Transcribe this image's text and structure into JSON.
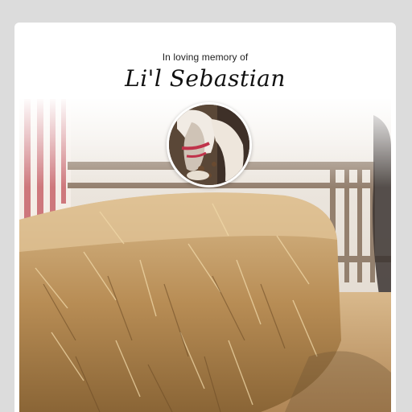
{
  "memorial": {
    "eyebrow": "In loving memory of",
    "name": "Li'l Sebastian"
  },
  "colors": {
    "page_bg": "#dcdcdc",
    "card_bg": "#ffffff",
    "hay": "#c9a062",
    "fence": "#7a6652"
  }
}
